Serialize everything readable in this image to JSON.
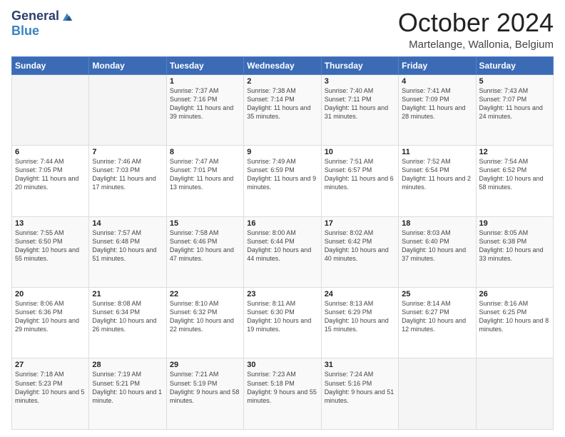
{
  "logo": {
    "general": "General",
    "blue": "Blue"
  },
  "header": {
    "month": "October 2024",
    "location": "Martelange, Wallonia, Belgium"
  },
  "weekdays": [
    "Sunday",
    "Monday",
    "Tuesday",
    "Wednesday",
    "Thursday",
    "Friday",
    "Saturday"
  ],
  "weeks": [
    [
      {
        "day": "",
        "info": ""
      },
      {
        "day": "",
        "info": ""
      },
      {
        "day": "1",
        "info": "Sunrise: 7:37 AM\nSunset: 7:16 PM\nDaylight: 11 hours and 39 minutes."
      },
      {
        "day": "2",
        "info": "Sunrise: 7:38 AM\nSunset: 7:14 PM\nDaylight: 11 hours and 35 minutes."
      },
      {
        "day": "3",
        "info": "Sunrise: 7:40 AM\nSunset: 7:11 PM\nDaylight: 11 hours and 31 minutes."
      },
      {
        "day": "4",
        "info": "Sunrise: 7:41 AM\nSunset: 7:09 PM\nDaylight: 11 hours and 28 minutes."
      },
      {
        "day": "5",
        "info": "Sunrise: 7:43 AM\nSunset: 7:07 PM\nDaylight: 11 hours and 24 minutes."
      }
    ],
    [
      {
        "day": "6",
        "info": "Sunrise: 7:44 AM\nSunset: 7:05 PM\nDaylight: 11 hours and 20 minutes."
      },
      {
        "day": "7",
        "info": "Sunrise: 7:46 AM\nSunset: 7:03 PM\nDaylight: 11 hours and 17 minutes."
      },
      {
        "day": "8",
        "info": "Sunrise: 7:47 AM\nSunset: 7:01 PM\nDaylight: 11 hours and 13 minutes."
      },
      {
        "day": "9",
        "info": "Sunrise: 7:49 AM\nSunset: 6:59 PM\nDaylight: 11 hours and 9 minutes."
      },
      {
        "day": "10",
        "info": "Sunrise: 7:51 AM\nSunset: 6:57 PM\nDaylight: 11 hours and 6 minutes."
      },
      {
        "day": "11",
        "info": "Sunrise: 7:52 AM\nSunset: 6:54 PM\nDaylight: 11 hours and 2 minutes."
      },
      {
        "day": "12",
        "info": "Sunrise: 7:54 AM\nSunset: 6:52 PM\nDaylight: 10 hours and 58 minutes."
      }
    ],
    [
      {
        "day": "13",
        "info": "Sunrise: 7:55 AM\nSunset: 6:50 PM\nDaylight: 10 hours and 55 minutes."
      },
      {
        "day": "14",
        "info": "Sunrise: 7:57 AM\nSunset: 6:48 PM\nDaylight: 10 hours and 51 minutes."
      },
      {
        "day": "15",
        "info": "Sunrise: 7:58 AM\nSunset: 6:46 PM\nDaylight: 10 hours and 47 minutes."
      },
      {
        "day": "16",
        "info": "Sunrise: 8:00 AM\nSunset: 6:44 PM\nDaylight: 10 hours and 44 minutes."
      },
      {
        "day": "17",
        "info": "Sunrise: 8:02 AM\nSunset: 6:42 PM\nDaylight: 10 hours and 40 minutes."
      },
      {
        "day": "18",
        "info": "Sunrise: 8:03 AM\nSunset: 6:40 PM\nDaylight: 10 hours and 37 minutes."
      },
      {
        "day": "19",
        "info": "Sunrise: 8:05 AM\nSunset: 6:38 PM\nDaylight: 10 hours and 33 minutes."
      }
    ],
    [
      {
        "day": "20",
        "info": "Sunrise: 8:06 AM\nSunset: 6:36 PM\nDaylight: 10 hours and 29 minutes."
      },
      {
        "day": "21",
        "info": "Sunrise: 8:08 AM\nSunset: 6:34 PM\nDaylight: 10 hours and 26 minutes."
      },
      {
        "day": "22",
        "info": "Sunrise: 8:10 AM\nSunset: 6:32 PM\nDaylight: 10 hours and 22 minutes."
      },
      {
        "day": "23",
        "info": "Sunrise: 8:11 AM\nSunset: 6:30 PM\nDaylight: 10 hours and 19 minutes."
      },
      {
        "day": "24",
        "info": "Sunrise: 8:13 AM\nSunset: 6:29 PM\nDaylight: 10 hours and 15 minutes."
      },
      {
        "day": "25",
        "info": "Sunrise: 8:14 AM\nSunset: 6:27 PM\nDaylight: 10 hours and 12 minutes."
      },
      {
        "day": "26",
        "info": "Sunrise: 8:16 AM\nSunset: 6:25 PM\nDaylight: 10 hours and 8 minutes."
      }
    ],
    [
      {
        "day": "27",
        "info": "Sunrise: 7:18 AM\nSunset: 5:23 PM\nDaylight: 10 hours and 5 minutes."
      },
      {
        "day": "28",
        "info": "Sunrise: 7:19 AM\nSunset: 5:21 PM\nDaylight: 10 hours and 1 minute."
      },
      {
        "day": "29",
        "info": "Sunrise: 7:21 AM\nSunset: 5:19 PM\nDaylight: 9 hours and 58 minutes."
      },
      {
        "day": "30",
        "info": "Sunrise: 7:23 AM\nSunset: 5:18 PM\nDaylight: 9 hours and 55 minutes."
      },
      {
        "day": "31",
        "info": "Sunrise: 7:24 AM\nSunset: 5:16 PM\nDaylight: 9 hours and 51 minutes."
      },
      {
        "day": "",
        "info": ""
      },
      {
        "day": "",
        "info": ""
      }
    ]
  ]
}
